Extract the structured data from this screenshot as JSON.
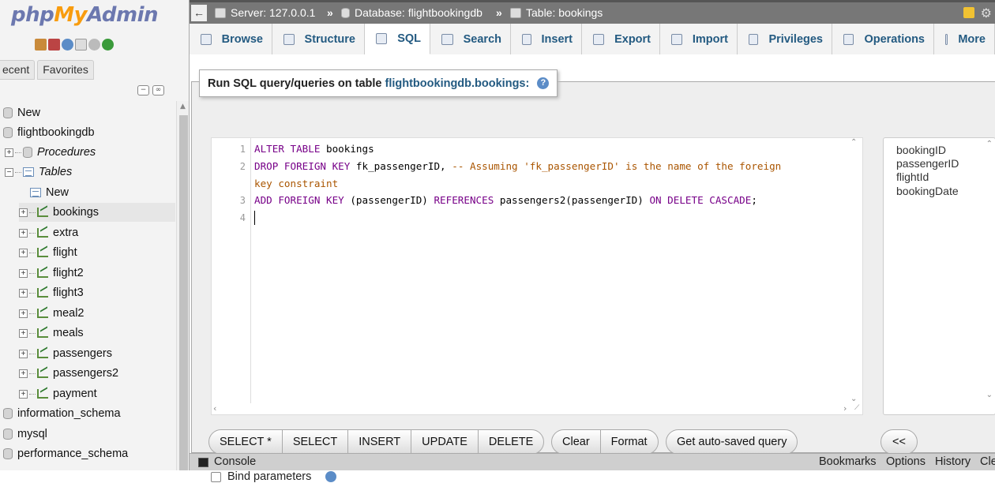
{
  "logo": {
    "php": "php",
    "my": "My",
    "admin": "Admin"
  },
  "nav": {
    "tabs": [
      "ecent",
      "Favorites"
    ],
    "tree": {
      "new": "New",
      "database": "flightbookingdb",
      "procedures": "Procedures",
      "tables": "Tables",
      "tables_new": "New",
      "table_items": [
        "bookings",
        "extra",
        "flight",
        "flight2",
        "flight3",
        "meal2",
        "meals",
        "passengers",
        "passengers2",
        "payment"
      ],
      "other_dbs": [
        "information_schema",
        "mysql",
        "performance_schema"
      ]
    }
  },
  "breadcrumb": {
    "server": "Server: 127.0.0.1",
    "database": "Database: flightbookingdb",
    "table": "Table: bookings",
    "separator": "»"
  },
  "tabs": [
    "Browse",
    "Structure",
    "SQL",
    "Search",
    "Insert",
    "Export",
    "Import",
    "Privileges",
    "Operations",
    "More"
  ],
  "active_tab": "SQL",
  "legend": {
    "prefix": "Run SQL query/queries on table ",
    "db_table": "flightbookingdb.bookings:",
    "help_icon": "help-icon"
  },
  "editor": {
    "line_numbers": [
      "1",
      "2",
      "3",
      "4"
    ],
    "line1_kw1": "ALTER TABLE",
    "line1_rest": " bookings",
    "line2_kw": "DROP FOREIGN KEY",
    "line2_rest": " fk_passengerID, ",
    "line2_comment": "-- Assuming 'fk_passengerID' is the name of the foreign",
    "line2_wrap": "key constraint",
    "line3_kw1": "ADD FOREIGN KEY",
    "line3_mid": " (passengerID) ",
    "line3_kw2": "REFERENCES",
    "line3_mid2": " passengers2(passengerID) ",
    "line3_kw3": "ON DELETE CASCADE",
    "line3_end": ";"
  },
  "columns": [
    "bookingID",
    "passengerID",
    "flightId",
    "bookingDate"
  ],
  "buttons": {
    "group1": [
      "SELECT *",
      "SELECT",
      "INSERT",
      "UPDATE",
      "DELETE"
    ],
    "group2": [
      "Clear",
      "Format"
    ],
    "autosaved": "Get auto-saved query",
    "insert_col": "<<"
  },
  "bind_parameters": "Bind parameters",
  "console": {
    "label": "Console",
    "bookmarks": "Bookmarks",
    "options": "Options",
    "history": "History",
    "clear": "Cle"
  }
}
